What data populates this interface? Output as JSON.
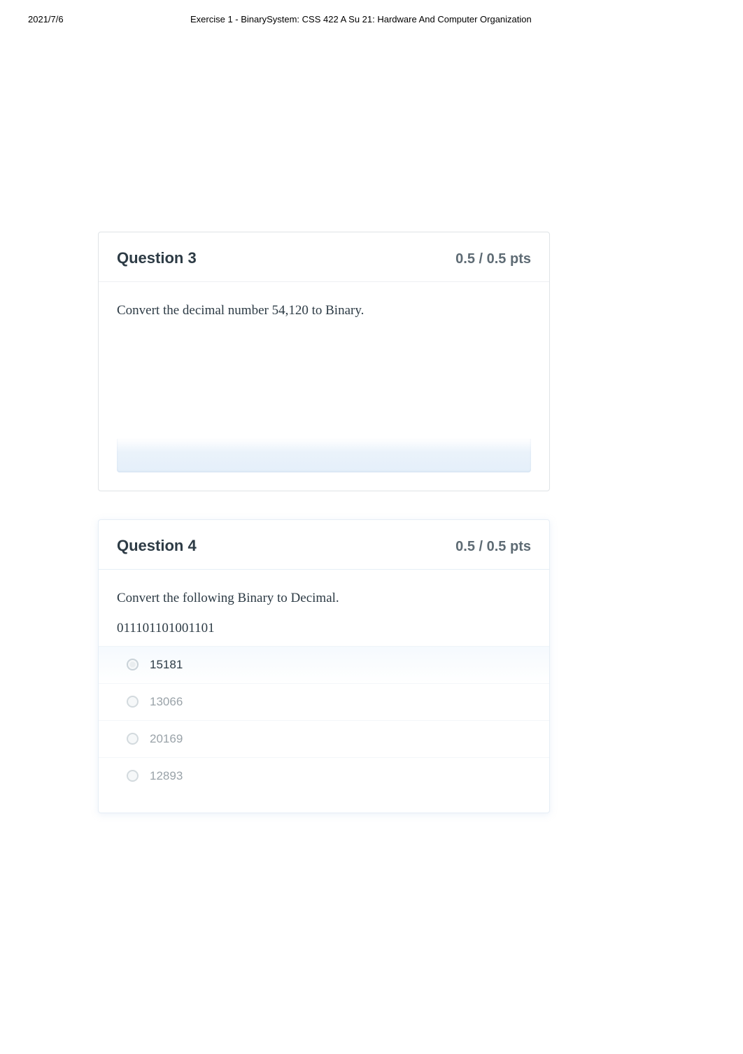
{
  "page": {
    "date": "2021/7/6",
    "header_title": "Exercise 1 - BinarySystem: CSS 422 A Su 21: Hardware And Computer Organization"
  },
  "q3": {
    "title": "Question 3",
    "points": "0.5 / 0.5 pts",
    "prompt": "Convert the decimal number 54,120 to Binary."
  },
  "q4": {
    "title": "Question 4",
    "points": "0.5 / 0.5 pts",
    "prompt": "Convert the following Binary to Decimal.",
    "binary": "011101101001101",
    "options": [
      "15181",
      "13066",
      "20169",
      "12893"
    ]
  }
}
